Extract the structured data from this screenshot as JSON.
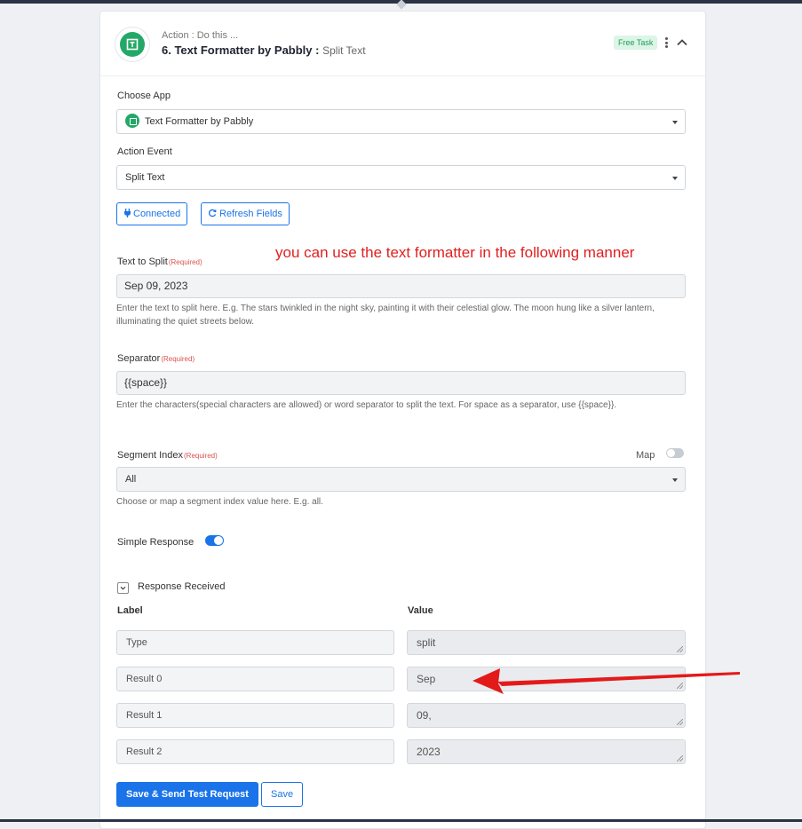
{
  "step": {
    "subtitle": "Action : Do this ...",
    "title": "6. Text Formatter by Pabbly :",
    "event": "Split Text",
    "badge": "Free Task"
  },
  "choose_app": {
    "label": "Choose App",
    "value": "Text Formatter by Pabbly"
  },
  "action_event": {
    "label": "Action Event",
    "value": "Split Text"
  },
  "buttons": {
    "connected": "Connected",
    "refresh": "Refresh Fields",
    "send_test": "Save & Send Test Request",
    "save": "Save"
  },
  "annotation": "you can use the text formatter in the following manner",
  "required_tag": "(Required)",
  "text_to_split": {
    "label": "Text to Split",
    "value": "Sep 09, 2023",
    "help": "Enter the text to split here. E.g. The stars twinkled in the night sky, painting it with their celestial glow. The moon hung like a silver lantern, illuminating the quiet streets below."
  },
  "separator": {
    "label": "Separator",
    "value": "{{space}}",
    "help": "Enter the characters(special characters are allowed) or word separator to split the text. For space as a separator, use {{space}}."
  },
  "segment_index": {
    "label": "Segment Index",
    "map_label": "Map",
    "value": "All",
    "help": "Choose or map a segment index value here. E.g. all."
  },
  "simple_response": {
    "label": "Simple Response",
    "enabled": true
  },
  "response": {
    "title": "Response Received",
    "label_header": "Label",
    "value_header": "Value",
    "rows": [
      {
        "label": "Type",
        "value": "split"
      },
      {
        "label": "Result 0",
        "value": "Sep"
      },
      {
        "label": "Result 1",
        "value": "09,"
      },
      {
        "label": "Result 2",
        "value": "2023"
      }
    ]
  },
  "colors": {
    "accent": "#1a73e8",
    "brand": "#23a867",
    "annotation": "#e02020"
  }
}
